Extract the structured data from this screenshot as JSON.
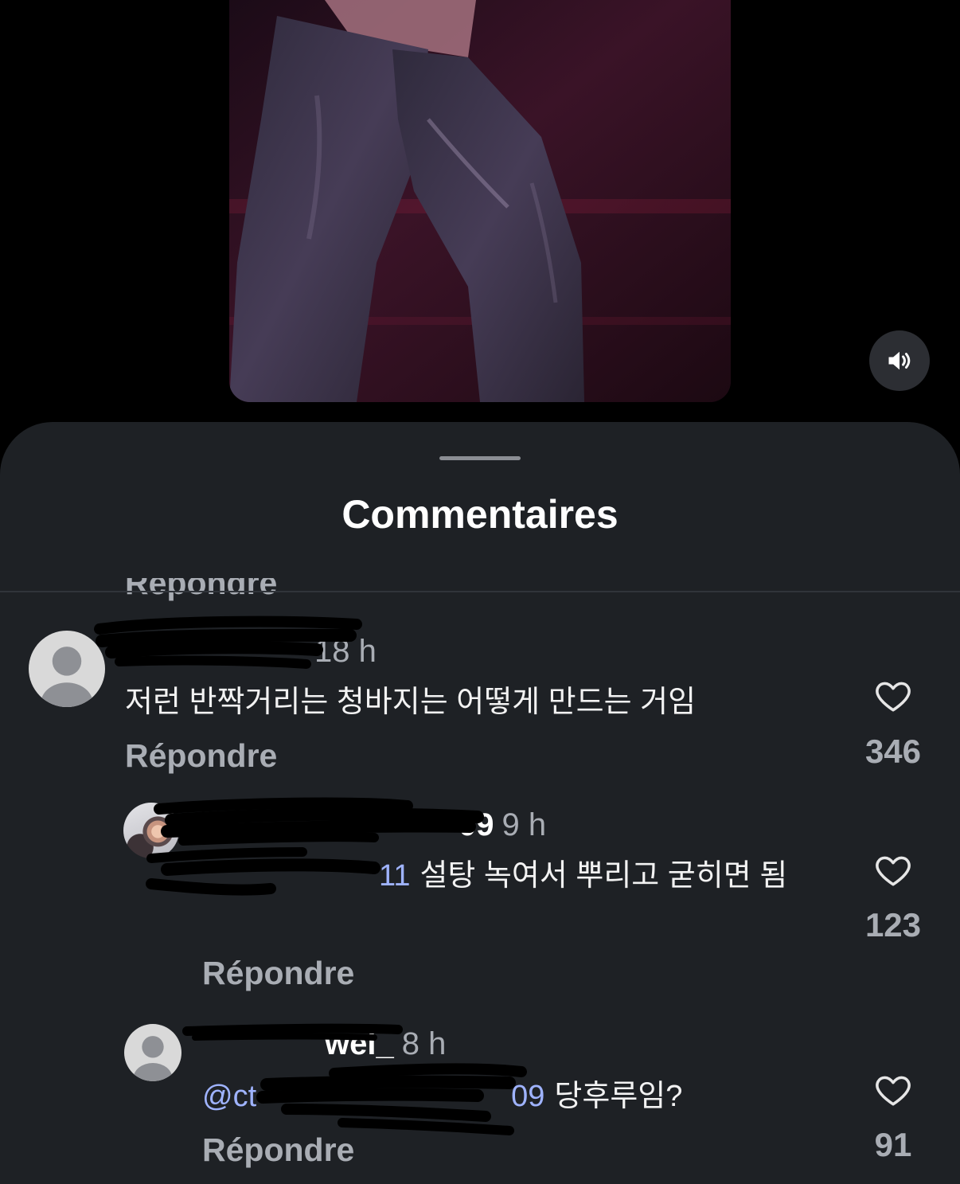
{
  "video": {
    "sound_icon": "speaker-on-icon"
  },
  "sheet": {
    "title": "Commentaires"
  },
  "top_partial_reply_label": "Répondre",
  "comments": [
    {
      "avatar": "default-avatar",
      "time": "18 h",
      "text": "저런 반짝거리는 청바지는 어떻게 만드는 거임",
      "reply_label": "Répondre",
      "like_icon": "heart-outline-icon",
      "likes": "346"
    },
    {
      "avatar": "photo-avatar",
      "username_visible": "09",
      "time": "9 h",
      "mention_visible": "11",
      "text": "설탕 녹여서 뿌리고 굳히면 됨",
      "reply_label": "Répondre",
      "like_icon": "heart-outline-icon",
      "likes": "123"
    },
    {
      "avatar": "default-avatar",
      "username_visible": "wei_",
      "time": "8 h",
      "mention_prefix": "@ct",
      "mention_suffix": "09",
      "text": "당후루임?",
      "reply_label": "Répondre",
      "like_icon": "heart-outline-icon",
      "likes": "91"
    }
  ],
  "colors": {
    "sheet_background": "#1e2125",
    "muted_text": "#a9adb4",
    "mention": "#9fb3ff"
  }
}
